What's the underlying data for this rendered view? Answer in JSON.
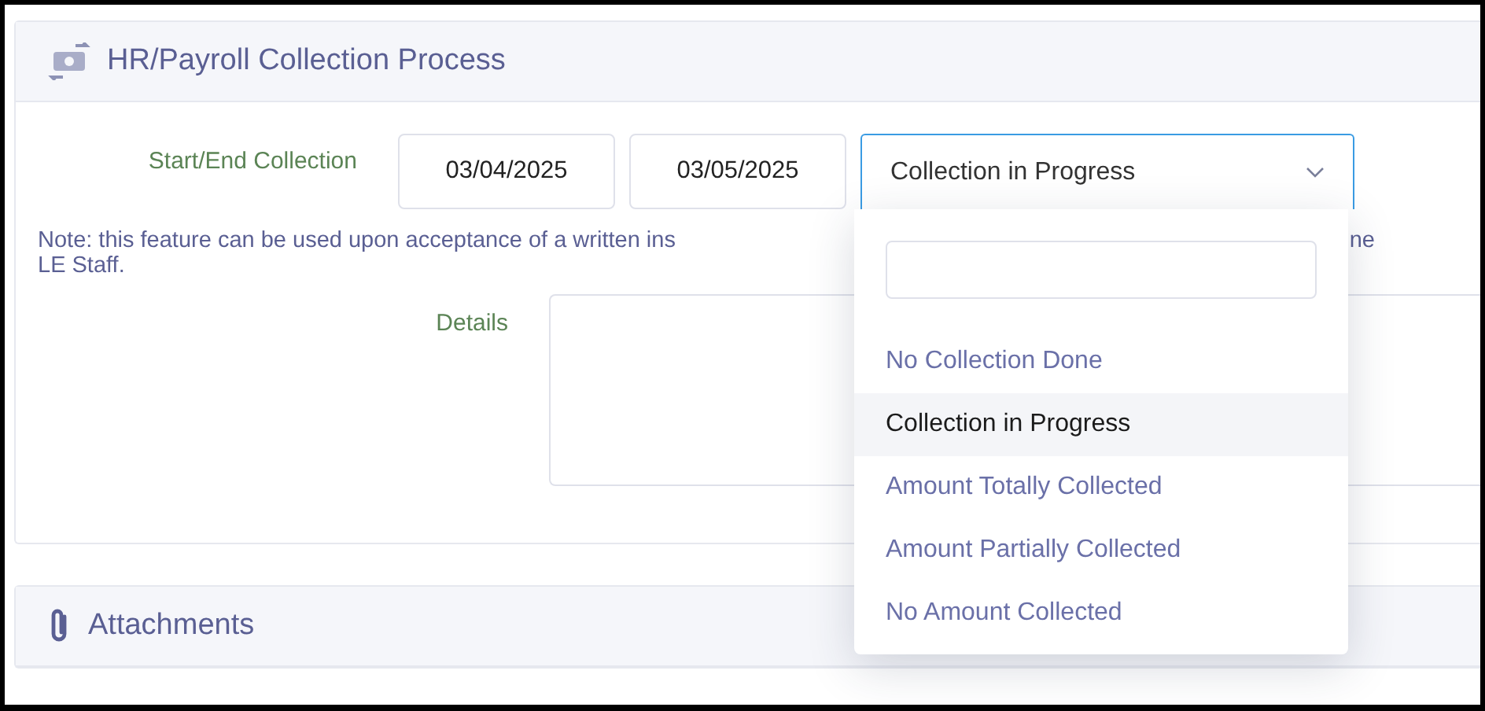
{
  "collection_panel": {
    "title": "HR/Payroll Collection Process",
    "start_end_label": "Start/End Collection",
    "start_date": "03/04/2025",
    "end_date": "03/05/2025",
    "status_select": {
      "value": "Collection in Progress",
      "expanded": true
    },
    "note_start": "Note: this feature can be used upon acceptance of a written ins",
    "note_end": "ne",
    "note_line_2": "LE Staff.",
    "details_label": "Details"
  },
  "dropdown": {
    "options": [
      {
        "label": "No Collection Done",
        "selected": false
      },
      {
        "label": "Collection in Progress",
        "selected": true
      },
      {
        "label": "Amount Totally Collected",
        "selected": false
      },
      {
        "label": "Amount Partially Collected",
        "selected": false
      },
      {
        "label": "No Amount Collected",
        "selected": false
      }
    ]
  },
  "attachments_panel": {
    "title": "Attachments"
  }
}
